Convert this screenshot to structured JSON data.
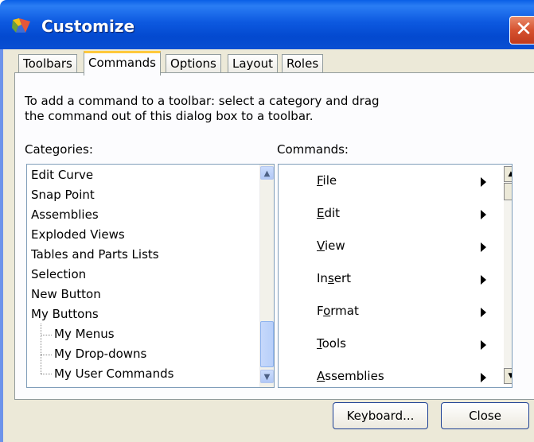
{
  "window": {
    "title": "Customize",
    "icon": "app-icon",
    "close_glyph": "✕"
  },
  "tabs": [
    {
      "label": "Toolbars",
      "active": false
    },
    {
      "label": "Commands",
      "active": true
    },
    {
      "label": "Options",
      "active": false
    },
    {
      "label": "Layout",
      "active": false
    },
    {
      "label": "Roles",
      "active": false
    }
  ],
  "instructions": {
    "line1": "To add a command to a toolbar: select a category and drag",
    "line2": "the command out of this dialog box to a toolbar."
  },
  "categories": {
    "label": "Categories:",
    "items": [
      "Edit Curve",
      "Snap Point",
      "Assemblies",
      "Exploded Views",
      "Tables and Parts Lists",
      "Selection",
      "New Button",
      "My Buttons"
    ],
    "sub_items": [
      "My Menus",
      "My Drop-downs",
      "My User Commands"
    ]
  },
  "commands": {
    "label": "Commands:",
    "items": [
      {
        "mn": "F",
        "rest": "ile"
      },
      {
        "mn": "E",
        "rest": "dit"
      },
      {
        "mn": "V",
        "rest": "iew"
      },
      {
        "pre": "In",
        "mn": "s",
        "rest": "ert"
      },
      {
        "pre": "F",
        "mn": "o",
        "rest": "rmat"
      },
      {
        "mn": "T",
        "rest": "ools"
      },
      {
        "mn": "A",
        "rest": "ssemblies"
      }
    ]
  },
  "buttons": {
    "keyboard": "Keyboard...",
    "close": "Close"
  }
}
